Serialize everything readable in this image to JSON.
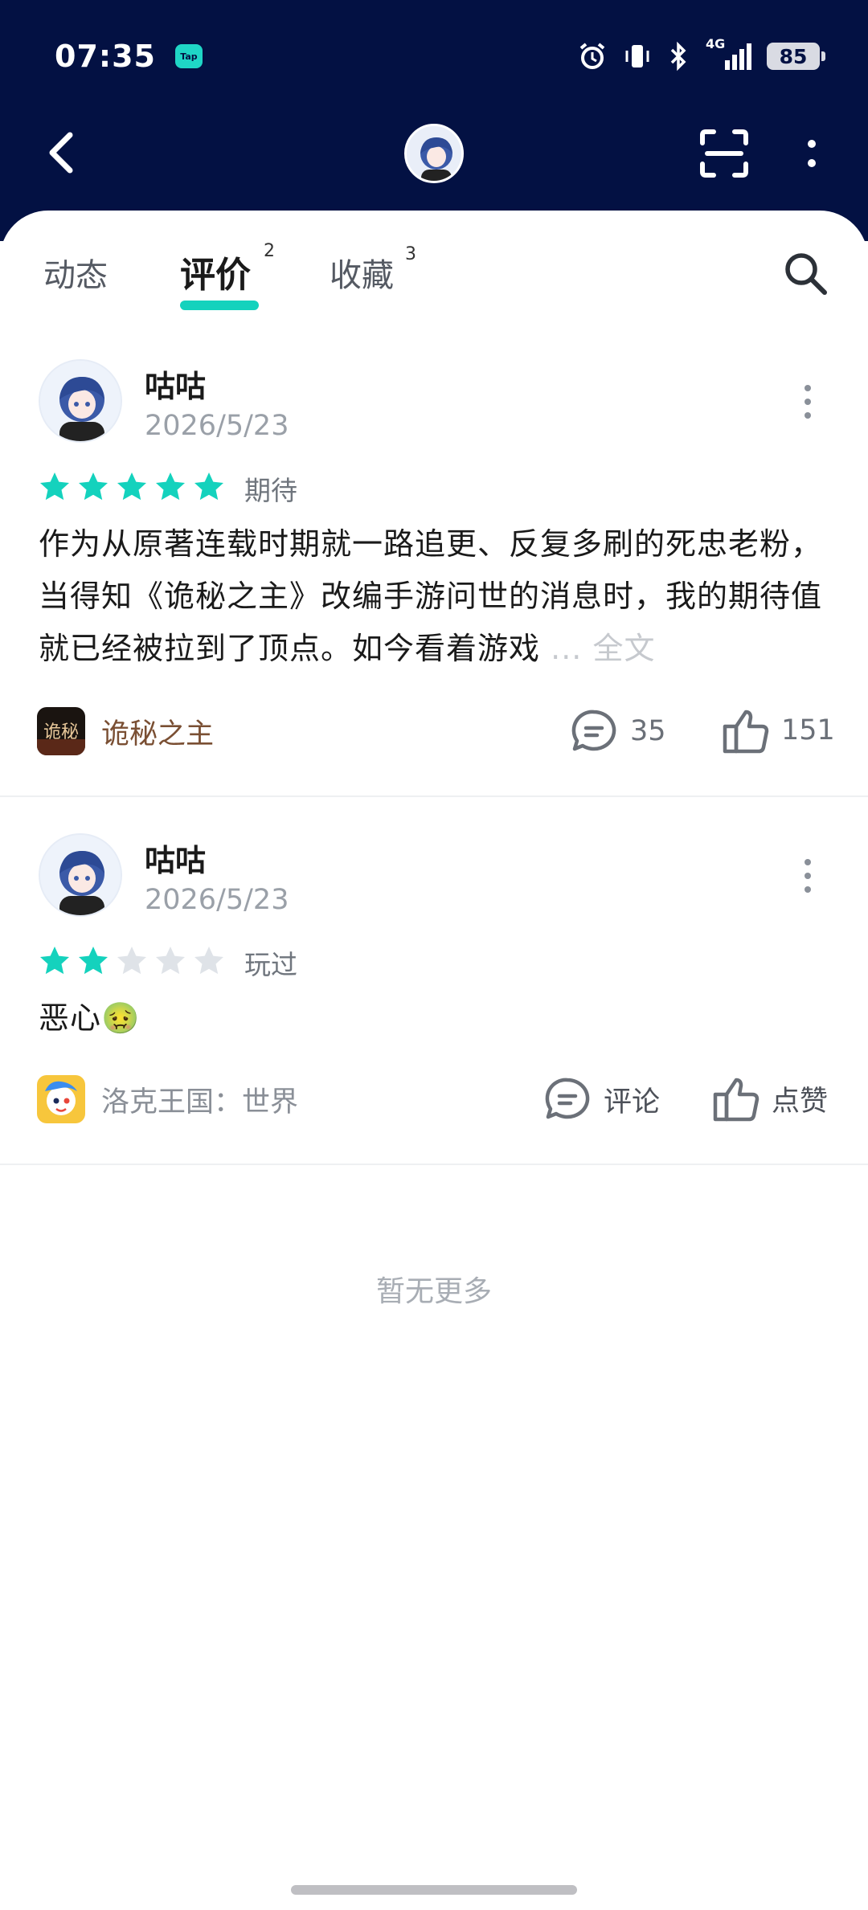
{
  "status_bar": {
    "time": "07:35",
    "app_badge": "Tap",
    "network": "4G",
    "battery": "85"
  },
  "tabs": [
    {
      "label": "动态",
      "count": ""
    },
    {
      "label": "评价",
      "count": "2"
    },
    {
      "label": "收藏",
      "count": "3"
    }
  ],
  "active_tab": "评价",
  "reviews": [
    {
      "user": "咕咕",
      "date": "2026/5/23",
      "rating": 5,
      "rating_label": "期待",
      "text": "作为从原著连载时期就一路追更、反复多刷的死忠老粉，当得知《诡秘之主》改编手游问世的消息时，我的期待值就已经被拉到了顶点。如今看着游戏",
      "ellipsis": "...",
      "fulltext_label": "全文",
      "game": "诡秘之主",
      "game_icon_text": "诡秘",
      "game_color": "#7a4f33",
      "comment_label": "35",
      "like_label": "151"
    },
    {
      "user": "咕咕",
      "date": "2026/5/23",
      "rating": 2,
      "rating_label": "玩过",
      "text": "恶心🤢",
      "game": "洛克王国：世界",
      "game_color": "#8a8f97",
      "comment_label": "评论",
      "like_label": "点赞"
    }
  ],
  "footer": {
    "no_more": "暂无更多"
  },
  "colors": {
    "header_bg": "#031143",
    "accent": "#14d2bd",
    "star_off": "#dfe3e8"
  }
}
